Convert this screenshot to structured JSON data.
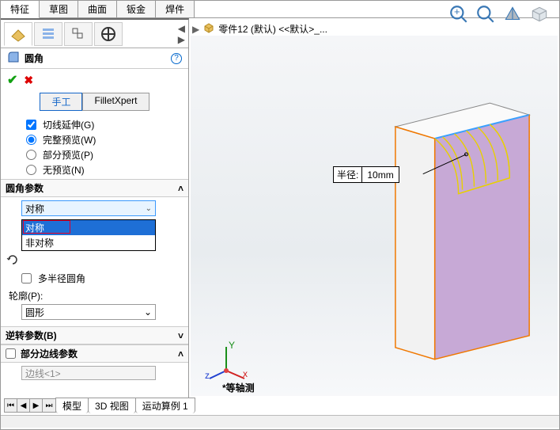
{
  "top_tabs": [
    "特征",
    "草图",
    "曲面",
    "钣金",
    "焊件"
  ],
  "breadcrumb": {
    "icon": "part",
    "label": "零件12 (默认) <<默认>_..."
  },
  "pm": {
    "title": "圆角",
    "sub_tabs": {
      "manual": "手工",
      "fxpert": "FilletXpert"
    },
    "check_tangent": "切线延伸(G)",
    "radio_full": "完整预览(W)",
    "radio_partial": "部分预览(P)",
    "radio_none": "无预览(N)",
    "sect_params": "圆角参数",
    "dd_value": "对称",
    "dd_options": [
      "对称",
      "非对称"
    ],
    "check_multiradius": "多半径圆角",
    "profile_label": "轮廓(P):",
    "profile_value": "圆形",
    "sect_reverse": "逆转参数(B)",
    "sect_partial": "部分边线参数",
    "edge_placeholder": "边线<1>"
  },
  "callout": {
    "label": "半径:",
    "value": "10mm"
  },
  "view_label": "*等轴测",
  "bottom_tabs": [
    "模型",
    "3D 视图",
    "运动算例 1"
  ]
}
